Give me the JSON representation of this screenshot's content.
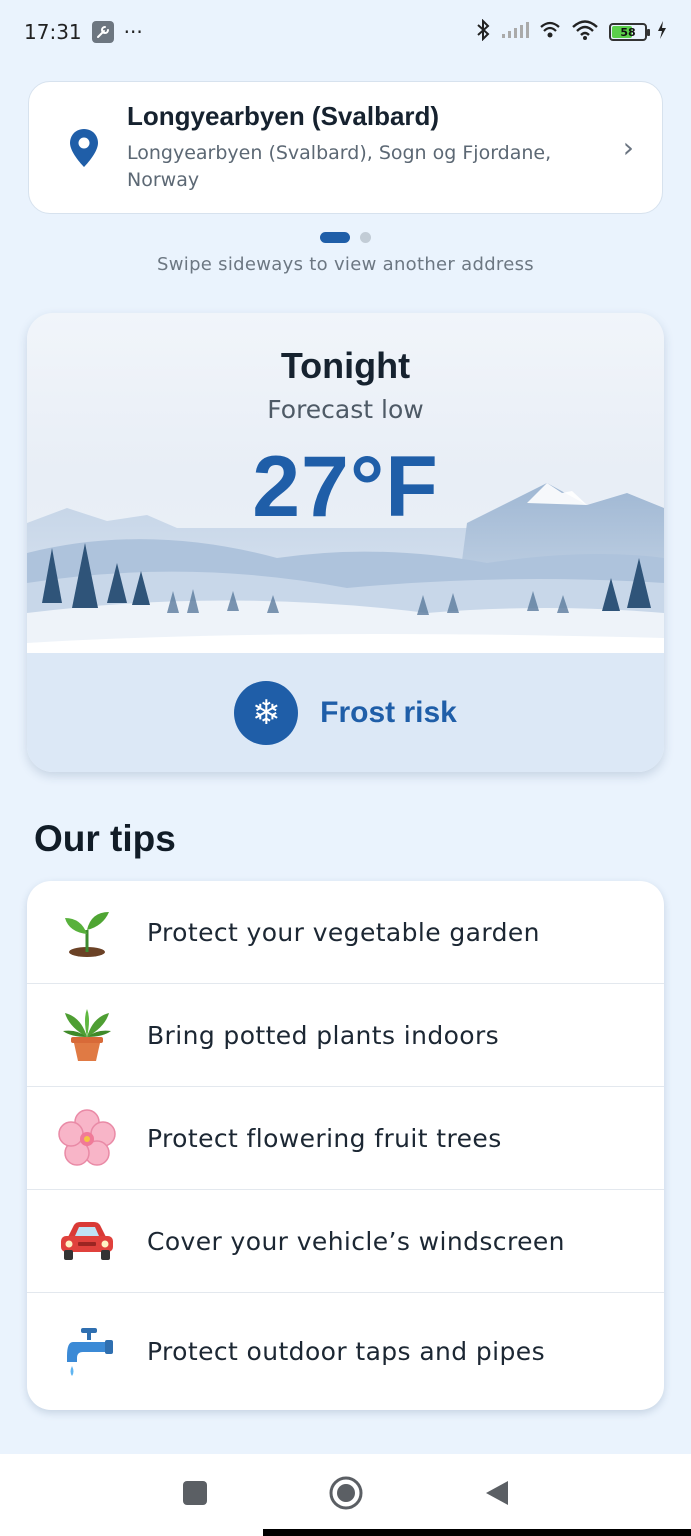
{
  "status_bar": {
    "time": "17:31",
    "more": "···",
    "battery": "58"
  },
  "address": {
    "title": "Longyearbyen (Svalbard)",
    "subtitle": "Longyearbyen (Svalbard), Sogn og Fjordane, Norway",
    "swipe_hint": "Swipe sideways to view another address",
    "page_count": 2,
    "active_page": 1
  },
  "forecast": {
    "title": "Tonight",
    "subtitle": "Forecast low",
    "temperature": "27°F",
    "risk_label": "Frost risk",
    "accent_color": "#1f5ea8"
  },
  "tips": {
    "heading": "Our tips",
    "items": [
      {
        "label": "Protect your vegetable garden",
        "icon": "seedling-icon"
      },
      {
        "label": "Bring potted plants indoors",
        "icon": "potted-plant-icon"
      },
      {
        "label": "Protect flowering fruit trees",
        "icon": "cherry-blossom-icon"
      },
      {
        "label": "Cover your vehicle’s windscreen",
        "icon": "car-icon"
      },
      {
        "label": "Protect outdoor taps and pipes",
        "icon": "water-tap-icon"
      }
    ]
  },
  "nav": {
    "recents": "recents-button",
    "home": "home-button",
    "back": "back-button"
  }
}
